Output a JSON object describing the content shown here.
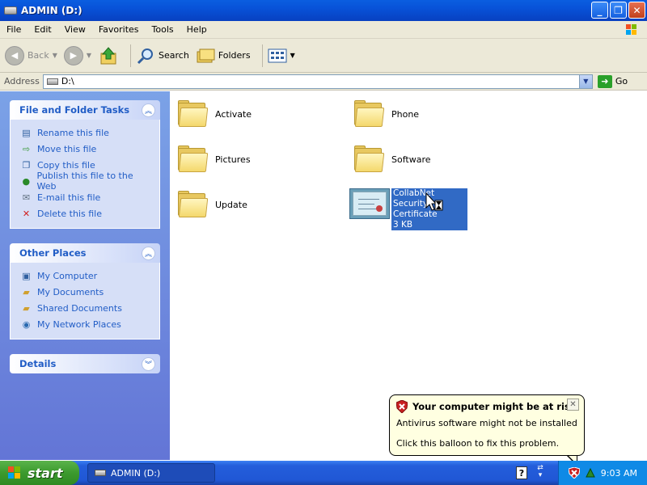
{
  "window": {
    "title": "ADMIN (D:)"
  },
  "menu": [
    "File",
    "Edit",
    "View",
    "Favorites",
    "Tools",
    "Help"
  ],
  "toolbar": {
    "back": "Back",
    "search": "Search",
    "folders": "Folders"
  },
  "address": {
    "label": "Address",
    "value": "D:\\",
    "go": "Go"
  },
  "sidebar": {
    "tasks": {
      "title": "File and Folder Tasks",
      "items": [
        "Rename this file",
        "Move this file",
        "Copy this file",
        "Publish this file to the Web",
        "E-mail this file",
        "Delete this file"
      ]
    },
    "places": {
      "title": "Other Places",
      "items": [
        "My Computer",
        "My Documents",
        "Shared Documents",
        "My Network Places"
      ]
    },
    "details": {
      "title": "Details"
    }
  },
  "files": {
    "folders": [
      "Activate",
      "Phone",
      "Pictures",
      "Software",
      "Update"
    ],
    "certificate": {
      "name_line1": "CollabNet",
      "name_line2": "Security Certificate",
      "size": "3 KB"
    }
  },
  "balloon": {
    "title": "Your computer might be at risk",
    "line1": "Antivirus software might not be installed",
    "line2": "Click this balloon to fix this problem."
  },
  "taskbar": {
    "start": "start",
    "task": "ADMIN (D:)",
    "clock": "9:03 AM"
  }
}
